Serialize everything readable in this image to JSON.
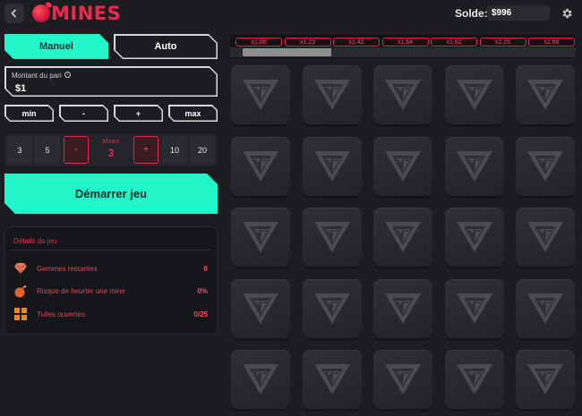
{
  "header": {
    "logo_text": "MINES",
    "balance_label": "Solde:",
    "balance_value": "$996",
    "icons": [
      "chevron-left-icon",
      "mine-ball-icon",
      "gear-icon"
    ]
  },
  "controls": {
    "mode_manual": "Manuel",
    "mode_auto": "Auto",
    "bet_label": "Montant du pari",
    "bet_info_icon": "info-icon",
    "bet_value": "$1",
    "quick": [
      "min",
      "-",
      "+",
      "max"
    ],
    "mines_options_left": [
      "3",
      "5"
    ],
    "mines_minus": "-",
    "mines_label": "Mines",
    "mines_value": "3",
    "mines_plus": "+",
    "mines_options_right": [
      "10",
      "20"
    ],
    "start_label": "Démarrer jeu"
  },
  "details": {
    "title": "Détails du jeu",
    "rows": [
      {
        "icon": "gem-icon",
        "label": "Gemmes restantes",
        "value": "0"
      },
      {
        "icon": "bomb-icon",
        "label": "Risque de heurter une mine",
        "value": "0%"
      },
      {
        "icon": "tiles-icon",
        "label": "Tuiles ouvertes",
        "value": "0/25"
      }
    ]
  },
  "multipliers": [
    "x1.08",
    "x1.23",
    "x1.42",
    "x1.64",
    "x1.92",
    "x2.25",
    "x2.68"
  ],
  "colors": {
    "accent": "#21f5c9",
    "danger": "#e3244a",
    "background": "#1c1d20",
    "tile": "#2a2b2f"
  },
  "grid": {
    "rows": 5,
    "columns": 5,
    "tile_icon": "triangle-logo-icon"
  }
}
